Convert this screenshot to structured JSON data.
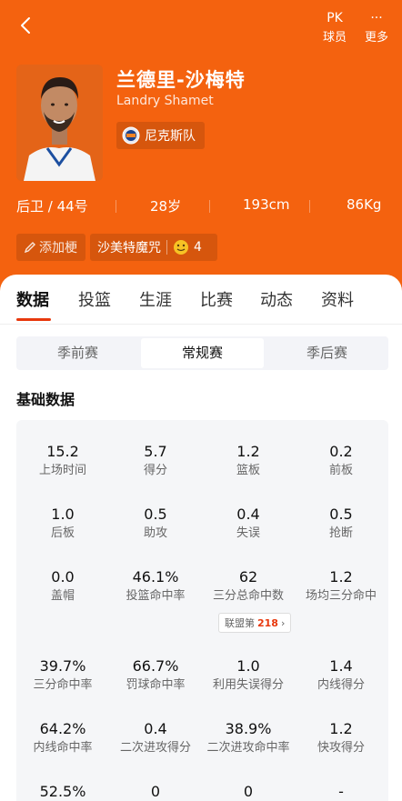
{
  "header": {
    "actions": [
      {
        "icon": "pk-icon",
        "icon_text": "PK",
        "label": "球员"
      },
      {
        "icon": "more-icon",
        "icon_text": "···",
        "label": "更多"
      }
    ]
  },
  "player": {
    "name_cn": "兰德里-沙梅特",
    "name_en": "Landry Shamet",
    "team": "尼克斯队",
    "position_number": "后卫 / 44号",
    "age": "28岁",
    "height": "193cm",
    "weight": "86Kg"
  },
  "tags": {
    "add_label": "添加梗",
    "tag_label": "沙美特魔咒",
    "tag_count": "4"
  },
  "tabs": [
    {
      "label": "数据",
      "active": true
    },
    {
      "label": "投篮"
    },
    {
      "label": "生涯"
    },
    {
      "label": "比赛"
    },
    {
      "label": "动态"
    },
    {
      "label": "资料"
    }
  ],
  "segments": [
    {
      "label": "季前赛"
    },
    {
      "label": "常规赛",
      "active": true
    },
    {
      "label": "季后赛"
    }
  ],
  "section_title": "基础数据",
  "stats": [
    {
      "value": "15.2",
      "label": "上场时间"
    },
    {
      "value": "5.7",
      "label": "得分"
    },
    {
      "value": "1.2",
      "label": "篮板"
    },
    {
      "value": "0.2",
      "label": "前板"
    },
    {
      "value": "1.0",
      "label": "后板"
    },
    {
      "value": "0.5",
      "label": "助攻"
    },
    {
      "value": "0.4",
      "label": "失误"
    },
    {
      "value": "0.5",
      "label": "抢断"
    },
    {
      "value": "0.0",
      "label": "盖帽"
    },
    {
      "value": "46.1%",
      "label": "投篮命中率"
    },
    {
      "value": "62",
      "label": "三分总命中数"
    },
    {
      "value": "1.2",
      "label": "场均三分命中"
    },
    {
      "value": "39.7%",
      "label": "三分命中率"
    },
    {
      "value": "66.7%",
      "label": "罚球命中率"
    },
    {
      "value": "1.0",
      "label": "利用失误得分"
    },
    {
      "value": "1.4",
      "label": "内线得分"
    },
    {
      "value": "64.2%",
      "label": "内线命中率"
    },
    {
      "value": "0.4",
      "label": "二次进攻得分"
    },
    {
      "value": "38.9%",
      "label": "二次进攻命中率"
    },
    {
      "value": "1.2",
      "label": "快攻得分"
    },
    {
      "value": "52.5%",
      "label": ""
    },
    {
      "value": "0",
      "label": ""
    },
    {
      "value": "0",
      "label": ""
    },
    {
      "value": "-",
      "label": ""
    }
  ],
  "rank_badge": {
    "prefix": "联盟第",
    "rank": "218",
    "arrow": "›"
  },
  "colors": {
    "header_bg": "#F4620F",
    "accent": "#E8380D"
  }
}
